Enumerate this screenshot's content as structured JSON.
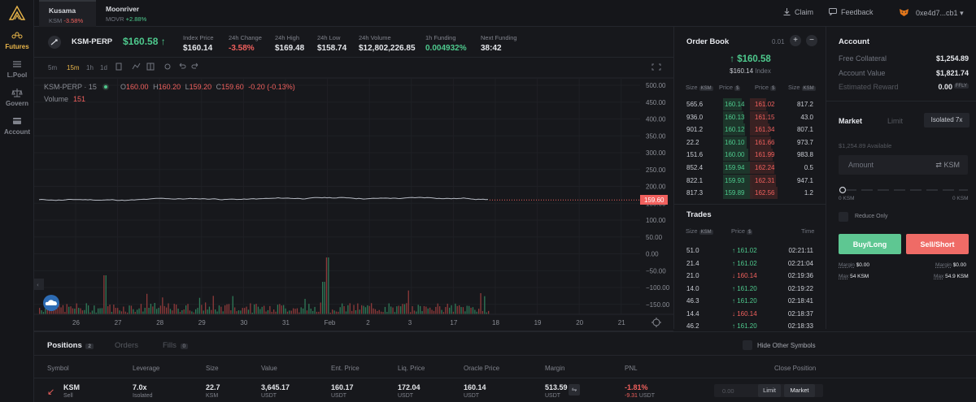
{
  "nav": {
    "items": [
      {
        "label": "Futures",
        "icon": "futures-icon"
      },
      {
        "label": "L.Pool",
        "icon": "pool-icon"
      },
      {
        "label": "Govern",
        "icon": "govern-icon"
      },
      {
        "label": "Account",
        "icon": "account-icon"
      }
    ]
  },
  "markets": [
    {
      "name": "Kusama",
      "symbol": "KSM",
      "change": "-3.58%"
    },
    {
      "name": "Moonriver",
      "symbol": "MOVR",
      "change": "+2.88%"
    }
  ],
  "topbar": {
    "claim": "Claim",
    "feedback": "Feedback",
    "wallet": "0xe4d7...cb1"
  },
  "ticker": {
    "symbol": "KSM-PERP",
    "price": "$160.58",
    "stats": [
      {
        "label": "Index Price",
        "value": "$160.14"
      },
      {
        "label": "24h Change",
        "value": "-3.58%"
      },
      {
        "label": "24h High",
        "value": "$169.48"
      },
      {
        "label": "24h Low",
        "value": "$158.74"
      },
      {
        "label": "24h Volume",
        "value": "$12,802,226.85"
      },
      {
        "label": "1h Funding",
        "value": "0.004932%"
      },
      {
        "label": "Next Funding",
        "value": "38:42"
      }
    ]
  },
  "chart": {
    "timeframes": [
      "5m",
      "15m",
      "1h",
      "1d"
    ],
    "legend_symbol": "KSM-PERP · 15",
    "ohlc": {
      "o": "160.00",
      "h": "160.20",
      "l": "159.20",
      "c": "159.60",
      "chg": "-0.20 (-0.13%)"
    },
    "volume_label": "Volume",
    "volume_value": "151",
    "last_price_tag": "159.60",
    "y_ticks": [
      "500.00",
      "450.00",
      "400.00",
      "350.00",
      "300.00",
      "250.00",
      "200.00",
      "150.00",
      "100.00",
      "50.00",
      "0.00",
      "−50.00",
      "−100.00",
      "−150.00"
    ],
    "x_ticks": [
      "26",
      "27",
      "28",
      "29",
      "30",
      "31",
      "Feb",
      "2",
      "3",
      "17",
      "18",
      "19",
      "20",
      "21"
    ],
    "price_level": 159.6
  },
  "orderbook": {
    "title": "Order Book",
    "tick": "0.01",
    "mid_price": "$160.58",
    "index_price": "$160.14",
    "index_label": "Index",
    "col_size": "Size",
    "col_price": "Price",
    "unit_ksm": "KSM",
    "unit_usd": "$",
    "rows": [
      {
        "bid_size": "565.6",
        "bid_price": "160.14",
        "ask_price": "161.02",
        "ask_size": "817.2"
      },
      {
        "bid_size": "936.0",
        "bid_price": "160.13",
        "ask_price": "161.15",
        "ask_size": "43.0"
      },
      {
        "bid_size": "901.2",
        "bid_price": "160.12",
        "ask_price": "161.34",
        "ask_size": "807.1"
      },
      {
        "bid_size": "22.2",
        "bid_price": "160.10",
        "ask_price": "161.66",
        "ask_size": "973.7"
      },
      {
        "bid_size": "151.6",
        "bid_price": "160.00",
        "ask_price": "161.99",
        "ask_size": "983.8"
      },
      {
        "bid_size": "852.4",
        "bid_price": "159.94",
        "ask_price": "162.24",
        "ask_size": "0.5"
      },
      {
        "bid_size": "822.1",
        "bid_price": "159.93",
        "ask_price": "162.31",
        "ask_size": "947.1"
      },
      {
        "bid_size": "817.3",
        "bid_price": "159.89",
        "ask_price": "162.56",
        "ask_size": "1.2"
      }
    ]
  },
  "trades": {
    "title": "Trades",
    "col_size": "Size",
    "col_price": "Price",
    "col_time": "Time",
    "rows": [
      {
        "size": "51.0",
        "price": "161.02",
        "dir": "up",
        "time": "02:21:11"
      },
      {
        "size": "21.4",
        "price": "161.02",
        "dir": "up",
        "time": "02:21:04"
      },
      {
        "size": "21.0",
        "price": "160.14",
        "dir": "down",
        "time": "02:19:36"
      },
      {
        "size": "14.0",
        "price": "161.20",
        "dir": "up",
        "time": "02:19:22"
      },
      {
        "size": "46.3",
        "price": "161.20",
        "dir": "up",
        "time": "02:18:41"
      },
      {
        "size": "14.4",
        "price": "160.14",
        "dir": "down",
        "time": "02:18:37"
      },
      {
        "size": "46.2",
        "price": "161.20",
        "dir": "up",
        "time": "02:18:33"
      }
    ]
  },
  "account": {
    "title": "Account",
    "free_collateral_label": "Free Collateral",
    "free_collateral": "$1,254.89",
    "account_value_label": "Account Value",
    "account_value": "$1,821.74",
    "est_reward_label": "Estimated Reward",
    "est_reward": "0.00",
    "reward_unit": "FFLY",
    "tab_market": "Market",
    "tab_limit": "Limit",
    "leverage_mode": "Isolated 7x",
    "available": "$1,254.89 Available",
    "amount_placeholder": "Amount",
    "amount_unit": "KSM",
    "slider_min": "0 KSM",
    "slider_max": "0 KSM",
    "reduce_only": "Reduce Only",
    "buy_label": "Buy/Long",
    "sell_label": "Sell/Short",
    "margin_label": "Margin",
    "buy_margin": "$0.00",
    "sell_margin": "$0.00",
    "max_label": "Max",
    "buy_max": "54 KSM",
    "sell_max": "54.9 KSM"
  },
  "positions": {
    "tabs": [
      {
        "label": "Positions",
        "count": "2"
      },
      {
        "label": "Orders",
        "count": ""
      },
      {
        "label": "Fills",
        "count": "0"
      }
    ],
    "hide_other": "Hide Other Symbols",
    "headers": [
      "Symbol",
      "Leverage",
      "Size",
      "Value",
      "Ent. Price",
      "Liq. Price",
      "Oracle Price",
      "Margin",
      "PNL",
      "Close Position"
    ],
    "row": {
      "symbol": "KSM",
      "side": "Sell",
      "leverage": "7.0x",
      "leverage_mode": "Isolated",
      "size": "22.7",
      "size_unit": "KSM",
      "value": "3,645.17",
      "value_unit": "USDT",
      "entry": "160.17",
      "entry_unit": "USDT",
      "liq": "172.04",
      "liq_unit": "USDT",
      "oracle": "160.14",
      "oracle_unit": "USDT",
      "margin": "513.59",
      "margin_unit": "USDT",
      "pnl_pct": "-1.81%",
      "pnl_value": "-9.31",
      "pnl_unit": "USDT",
      "close_placeholder": "0.00",
      "close_limit": "Limit",
      "close_market": "Market"
    }
  },
  "colors": {
    "bg": "#17181c",
    "green": "#4ec98d",
    "red": "#f0605d",
    "accent": "#e8b54a"
  }
}
